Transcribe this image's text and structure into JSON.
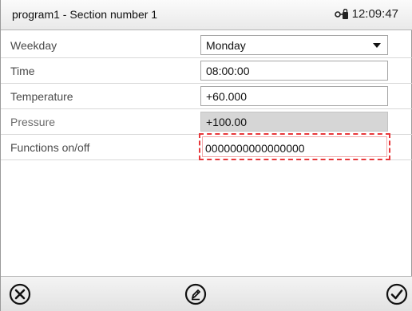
{
  "header": {
    "title": "program1 - Section number 1",
    "time": "12:09:47"
  },
  "rows": [
    {
      "label": "Weekday",
      "value": "Monday",
      "kind": "select"
    },
    {
      "label": "Time",
      "value": "08:00:00",
      "kind": "input"
    },
    {
      "label": "Temperature",
      "value": "+60.000",
      "kind": "input"
    },
    {
      "label": "Pressure",
      "value": "+100.00",
      "kind": "readonly"
    },
    {
      "label": "Functions on/off",
      "value": "0000000000000000",
      "kind": "input-error"
    }
  ],
  "footer": {
    "cancel_icon": "close-circle-icon",
    "edit_icon": "pencil-circle-icon",
    "confirm_icon": "checkmark-circle-icon"
  },
  "colors": {
    "error_border": "#e8383b",
    "readonly_bg": "#d6d6d6"
  }
}
